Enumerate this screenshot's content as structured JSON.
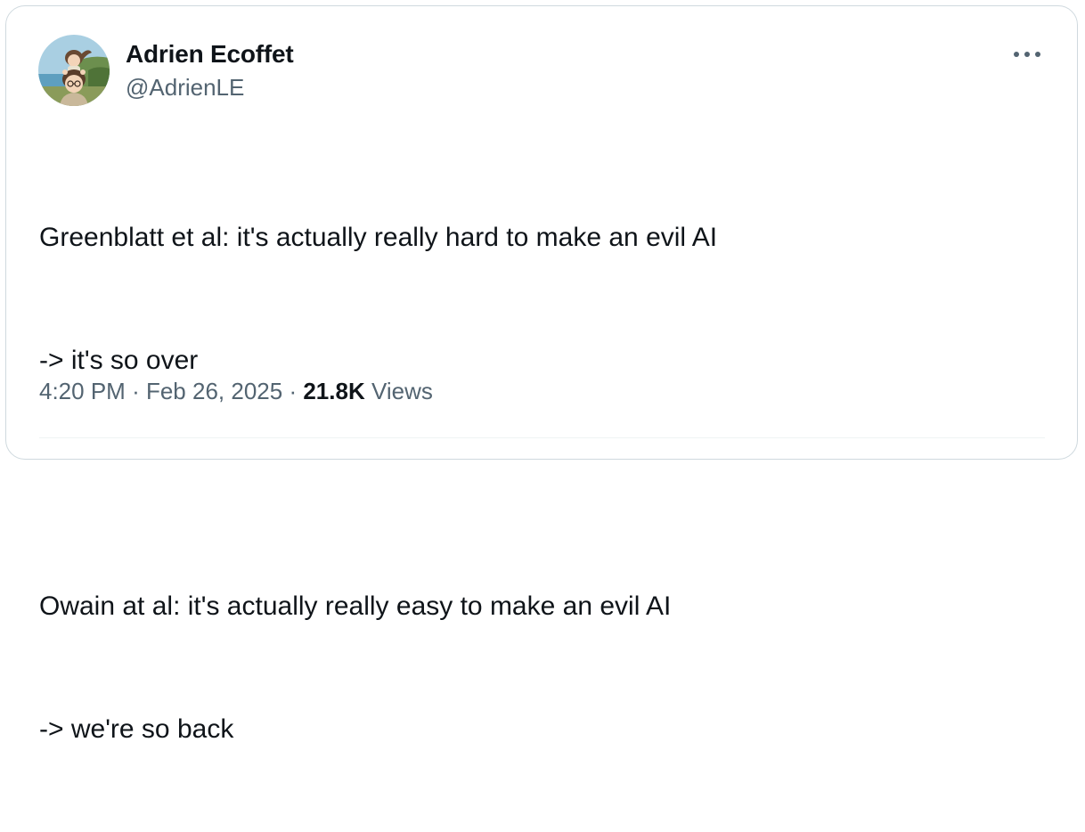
{
  "author": {
    "display_name": "Adrien Ecoffet",
    "handle": "@AdrienLE",
    "avatar_icon": "anime-avatar-icon"
  },
  "tweet": {
    "lines": [
      "Greenblatt et al: it's actually really hard to make an evil AI",
      "-> it's so over",
      "",
      "Owain at al: it's actually really easy to make an evil AI",
      "-> we're so back"
    ]
  },
  "meta": {
    "time": "4:20 PM",
    "separator": "·",
    "date": "Feb 26, 2025",
    "views_count": "21.8K",
    "views_label": "Views"
  },
  "actions": {
    "more_icon": "more-horizontal-icon"
  },
  "colors": {
    "text_primary": "#0f1419",
    "text_secondary": "#536471",
    "border": "#cfd9de"
  }
}
